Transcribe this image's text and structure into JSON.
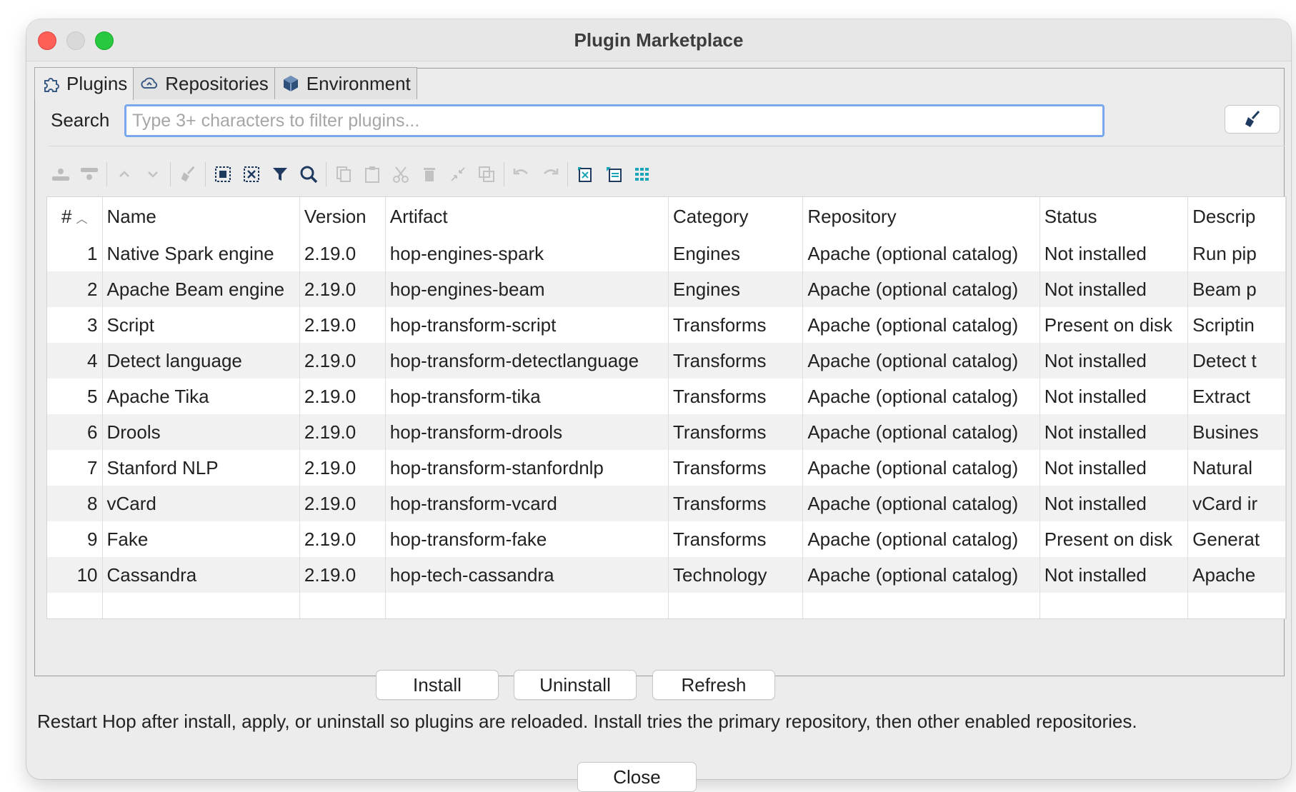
{
  "window": {
    "title": "Plugin Marketplace"
  },
  "tabs": [
    {
      "label": "Plugins",
      "icon": "puzzle-icon",
      "active": true
    },
    {
      "label": "Repositories",
      "icon": "cloud-icon",
      "active": false
    },
    {
      "label": "Environment",
      "icon": "cube-icon",
      "active": false
    }
  ],
  "search": {
    "label": "Search",
    "placeholder": "Type 3+ characters to filter plugins...",
    "value": ""
  },
  "table": {
    "columns": [
      "#",
      "Name",
      "Version",
      "Artifact",
      "Category",
      "Repository",
      "Status",
      "Descrip"
    ],
    "sort_column": "#",
    "rows": [
      {
        "num": "1",
        "name": "Native Spark engine",
        "version": "2.19.0",
        "artifact": "hop-engines-spark",
        "category": "Engines",
        "repository": "Apache (optional catalog)",
        "status": "Not installed",
        "description": "Run pip"
      },
      {
        "num": "2",
        "name": "Apache Beam engine",
        "version": "2.19.0",
        "artifact": "hop-engines-beam",
        "category": "Engines",
        "repository": "Apache (optional catalog)",
        "status": "Not installed",
        "description": "Beam p"
      },
      {
        "num": "3",
        "name": "Script",
        "version": "2.19.0",
        "artifact": "hop-transform-script",
        "category": "Transforms",
        "repository": "Apache (optional catalog)",
        "status": "Present on disk",
        "description": "Scriptin"
      },
      {
        "num": "4",
        "name": "Detect language",
        "version": "2.19.0",
        "artifact": "hop-transform-detectlanguage",
        "category": "Transforms",
        "repository": "Apache (optional catalog)",
        "status": "Not installed",
        "description": "Detect t"
      },
      {
        "num": "5",
        "name": "Apache Tika",
        "version": "2.19.0",
        "artifact": "hop-transform-tika",
        "category": "Transforms",
        "repository": "Apache (optional catalog)",
        "status": "Not installed",
        "description": "Extract"
      },
      {
        "num": "6",
        "name": "Drools",
        "version": "2.19.0",
        "artifact": "hop-transform-drools",
        "category": "Transforms",
        "repository": "Apache (optional catalog)",
        "status": "Not installed",
        "description": "Busines"
      },
      {
        "num": "7",
        "name": "Stanford NLP",
        "version": "2.19.0",
        "artifact": "hop-transform-stanfordnlp",
        "category": "Transforms",
        "repository": "Apache (optional catalog)",
        "status": "Not installed",
        "description": "Natural"
      },
      {
        "num": "8",
        "name": "vCard",
        "version": "2.19.0",
        "artifact": "hop-transform-vcard",
        "category": "Transforms",
        "repository": "Apache (optional catalog)",
        "status": "Not installed",
        "description": "vCard ir"
      },
      {
        "num": "9",
        "name": "Fake",
        "version": "2.19.0",
        "artifact": "hop-transform-fake",
        "category": "Transforms",
        "repository": "Apache (optional catalog)",
        "status": "Present on disk",
        "description": "Generat"
      },
      {
        "num": "10",
        "name": "Cassandra",
        "version": "2.19.0",
        "artifact": "hop-tech-cassandra",
        "category": "Technology",
        "repository": "Apache (optional catalog)",
        "status": "Not installed",
        "description": "Apache"
      }
    ]
  },
  "actions": {
    "install": "Install",
    "uninstall": "Uninstall",
    "refresh": "Refresh"
  },
  "info_text": "Restart Hop after install, apply, or uninstall so plugins are reloaded. Install tries the primary repository, then other enabled repositories.",
  "close_label": "Close",
  "colors": {
    "accent_focus": "#7aa8ec",
    "close": "#fe5f57",
    "minimize": "#d9d9d9",
    "maximize": "#28c840",
    "toolbar_active": "#1f3a5f",
    "toolbar_disabled": "#b9b9b9",
    "teal_icon": "#1aa5b8"
  }
}
